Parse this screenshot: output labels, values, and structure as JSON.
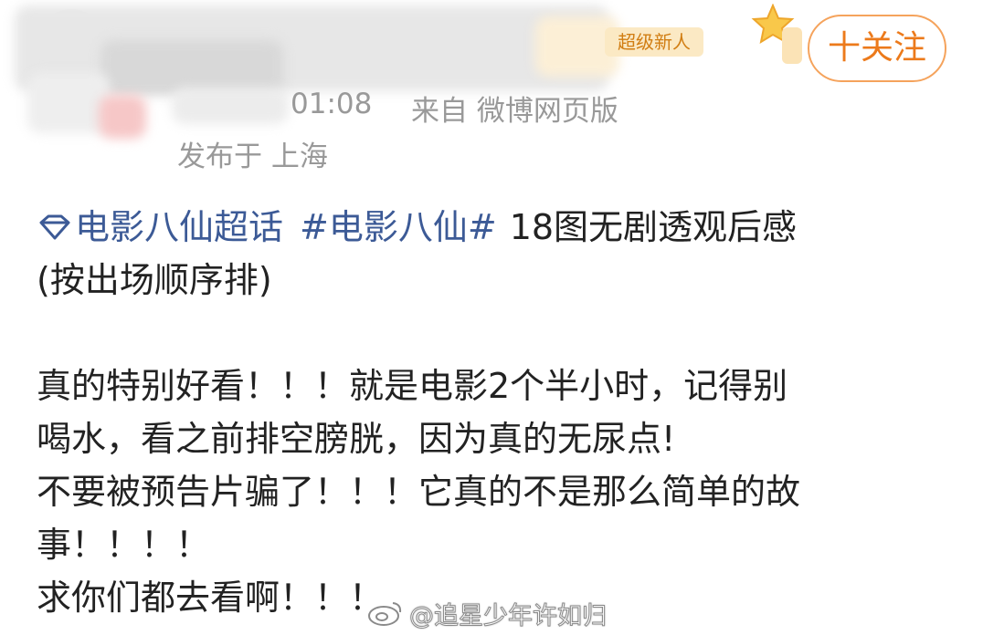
{
  "header": {
    "user_badge": "超级新人",
    "follow_button": "十关注",
    "time_partial": "01:08",
    "source": "来自 微博网页版",
    "location": "发布于 上海"
  },
  "post": {
    "topics": [
      "电影八仙超话",
      "#电影八仙#"
    ],
    "title_rest": "18图无剧透观后感",
    "title_line2": "(按出场顺序排)",
    "body_lines": [
      "真的特别好看！！！就是电影2个半小时，记得别",
      "喝水，看之前排空膀胱，因为真的无尿点!",
      "不要被预告片骗了！！！它真的不是那么简单的故",
      "事！！！！",
      "求你们都去看啊！！！"
    ]
  },
  "watermark": {
    "text": "@追星少年许如归"
  },
  "colors": {
    "topic_link": "#3c5a96",
    "follow_orange": "#ec7a1b",
    "badge_bg": "#fbe9c4",
    "meta_gray": "#999999"
  }
}
